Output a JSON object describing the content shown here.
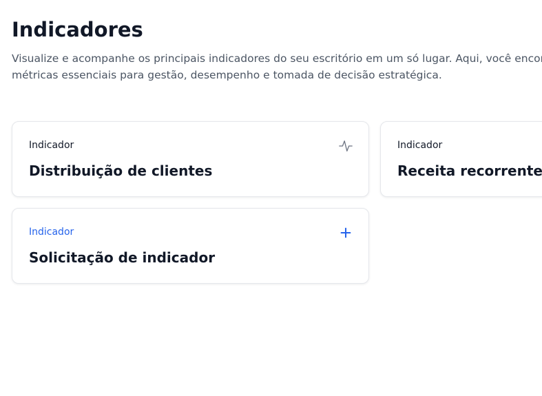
{
  "header": {
    "title": "Indicadores",
    "description_line1": "Visualize e acompanhe os principais indicadores do seu escritório em um só lugar. Aqui, você encontra",
    "description_line2": "métricas essenciais para gestão, desempenho e tomada de decisão estratégica."
  },
  "cards": [
    {
      "kicker": "Indicador",
      "title": "Distribuição de clientes",
      "icon": "activity-pulse-icon"
    },
    {
      "kicker": "Indicador",
      "title": "Receita recorrente",
      "icon": "none"
    },
    {
      "kicker": "Indicador",
      "title": "Solicitação de indicador",
      "icon": "plus-icon"
    }
  ],
  "colors": {
    "text_primary": "#111827",
    "text_secondary": "#4b5563",
    "accent": "#2563eb",
    "card_border": "#e5e7eb"
  }
}
